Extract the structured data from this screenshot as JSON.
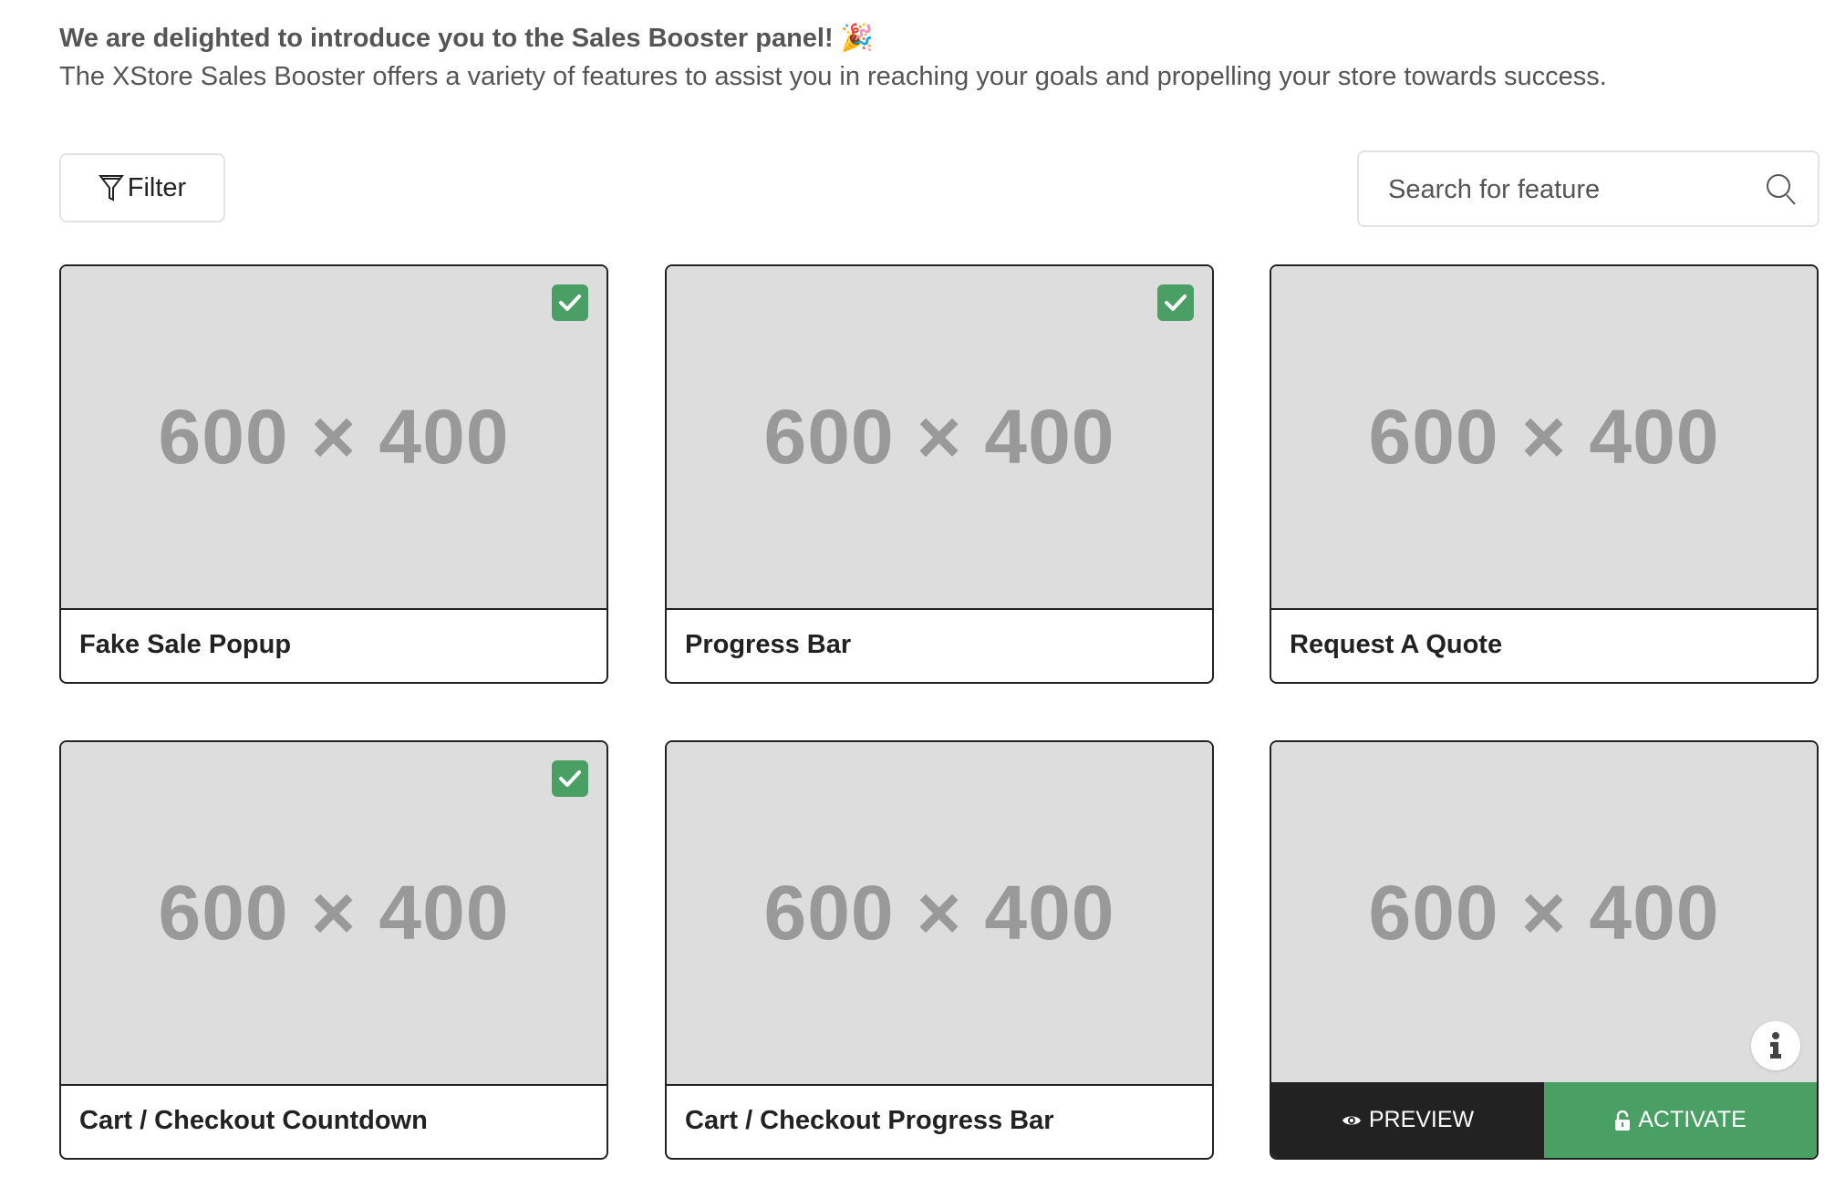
{
  "intro": {
    "heading": "We are delighted to introduce you to the Sales Booster panel! 🎉",
    "description": "The XStore Sales Booster offers a variety of features to assist you in reaching your goals and propelling your store towards success."
  },
  "toolbar": {
    "filter_label": "Filter",
    "search_placeholder": "Search for feature",
    "search_value": ""
  },
  "colors": {
    "active_green": "#4a9f65",
    "dark": "#222222",
    "placeholder_bg": "#dddddd"
  },
  "features": [
    {
      "title": "Fake Sale Popup",
      "image_text": "600 × 400",
      "active": true
    },
    {
      "title": "Progress Bar",
      "image_text": "600 × 400",
      "active": true
    },
    {
      "title": "Request A Quote",
      "image_text": "600 × 400",
      "active": false
    },
    {
      "title": "Cart / Checkout Countdown",
      "image_text": "600 × 400",
      "active": true
    },
    {
      "title": "Cart / Checkout Progress Bar",
      "image_text": "600 × 400",
      "active": false
    },
    {
      "title": "",
      "image_text": "600 × 400",
      "active": false,
      "hovered": true,
      "preview_label": "Preview",
      "activate_label": "Activate"
    }
  ]
}
